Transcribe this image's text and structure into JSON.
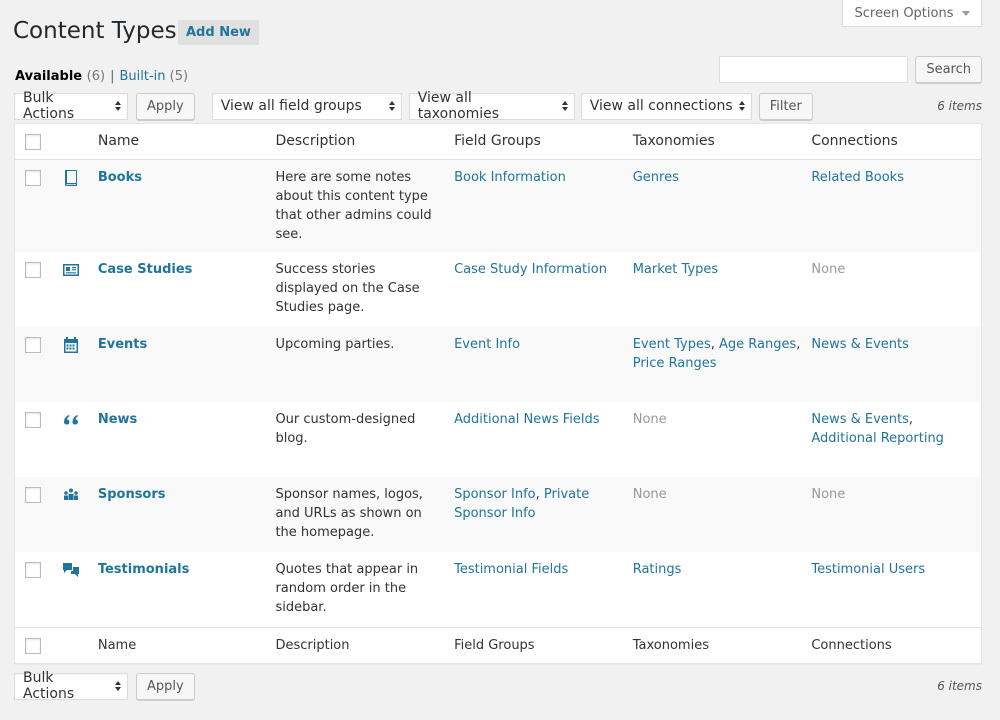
{
  "screen_options": {
    "label": "Screen Options"
  },
  "page": {
    "title": "Content Types",
    "add_new": "Add New"
  },
  "views": {
    "available_label": "Available",
    "available_count": "(6)",
    "separator": "|",
    "builtin_label": "Built-in",
    "builtin_count": "(5)"
  },
  "search": {
    "placeholder": "",
    "button": "Search"
  },
  "toolbar": {
    "bulk_actions": "Bulk Actions",
    "apply": "Apply",
    "field_groups_filter": "View all field groups",
    "taxonomies_filter": "View all taxonomies",
    "connections_filter": "View all connections",
    "filter": "Filter",
    "items_count": "6 items"
  },
  "columns": {
    "name": "Name",
    "description": "Description",
    "field_groups": "Field Groups",
    "taxonomies": "Taxonomies",
    "connections": "Connections"
  },
  "rows": [
    {
      "icon": "book-icon",
      "name": "Books",
      "description": "Here are some notes about this content type that other admins could see.",
      "field_groups": [
        "Book Information"
      ],
      "taxonomies": [
        "Genres"
      ],
      "connections": [
        "Related Books"
      ]
    },
    {
      "icon": "id-card-icon",
      "name": "Case Studies",
      "description": "Success stories displayed on the Case Studies page.",
      "field_groups": [
        "Case Study Information"
      ],
      "taxonomies": [
        "Market Types"
      ],
      "connections": []
    },
    {
      "icon": "calendar-icon",
      "name": "Events",
      "description": "Upcoming parties.",
      "field_groups": [
        "Event Info"
      ],
      "taxonomies": [
        "Event Types",
        "Age Ranges",
        "Price Ranges"
      ],
      "connections": [
        "News & Events"
      ]
    },
    {
      "icon": "quote-icon",
      "name": "News",
      "description": "Our custom-designed blog.",
      "field_groups": [
        "Additional News Fields"
      ],
      "taxonomies": [],
      "connections": [
        "News & Events",
        "Additional Reporting"
      ]
    },
    {
      "icon": "groups-icon",
      "name": "Sponsors",
      "description": "Sponsor names, logos, and URLs as shown on the homepage.",
      "field_groups": [
        "Sponsor Info",
        "Private Sponsor Info"
      ],
      "taxonomies": [],
      "connections": []
    },
    {
      "icon": "testimonial-icon",
      "name": "Testimonials",
      "description": "Quotes that appear in random order in the sidebar.",
      "field_groups": [
        "Testimonial Fields"
      ],
      "taxonomies": [
        "Ratings"
      ],
      "connections": [
        "Testimonial Users"
      ]
    }
  ],
  "none_label": "None",
  "colors": {
    "link": "#21759b",
    "muted": "#999999",
    "background": "#f1f1f1"
  }
}
